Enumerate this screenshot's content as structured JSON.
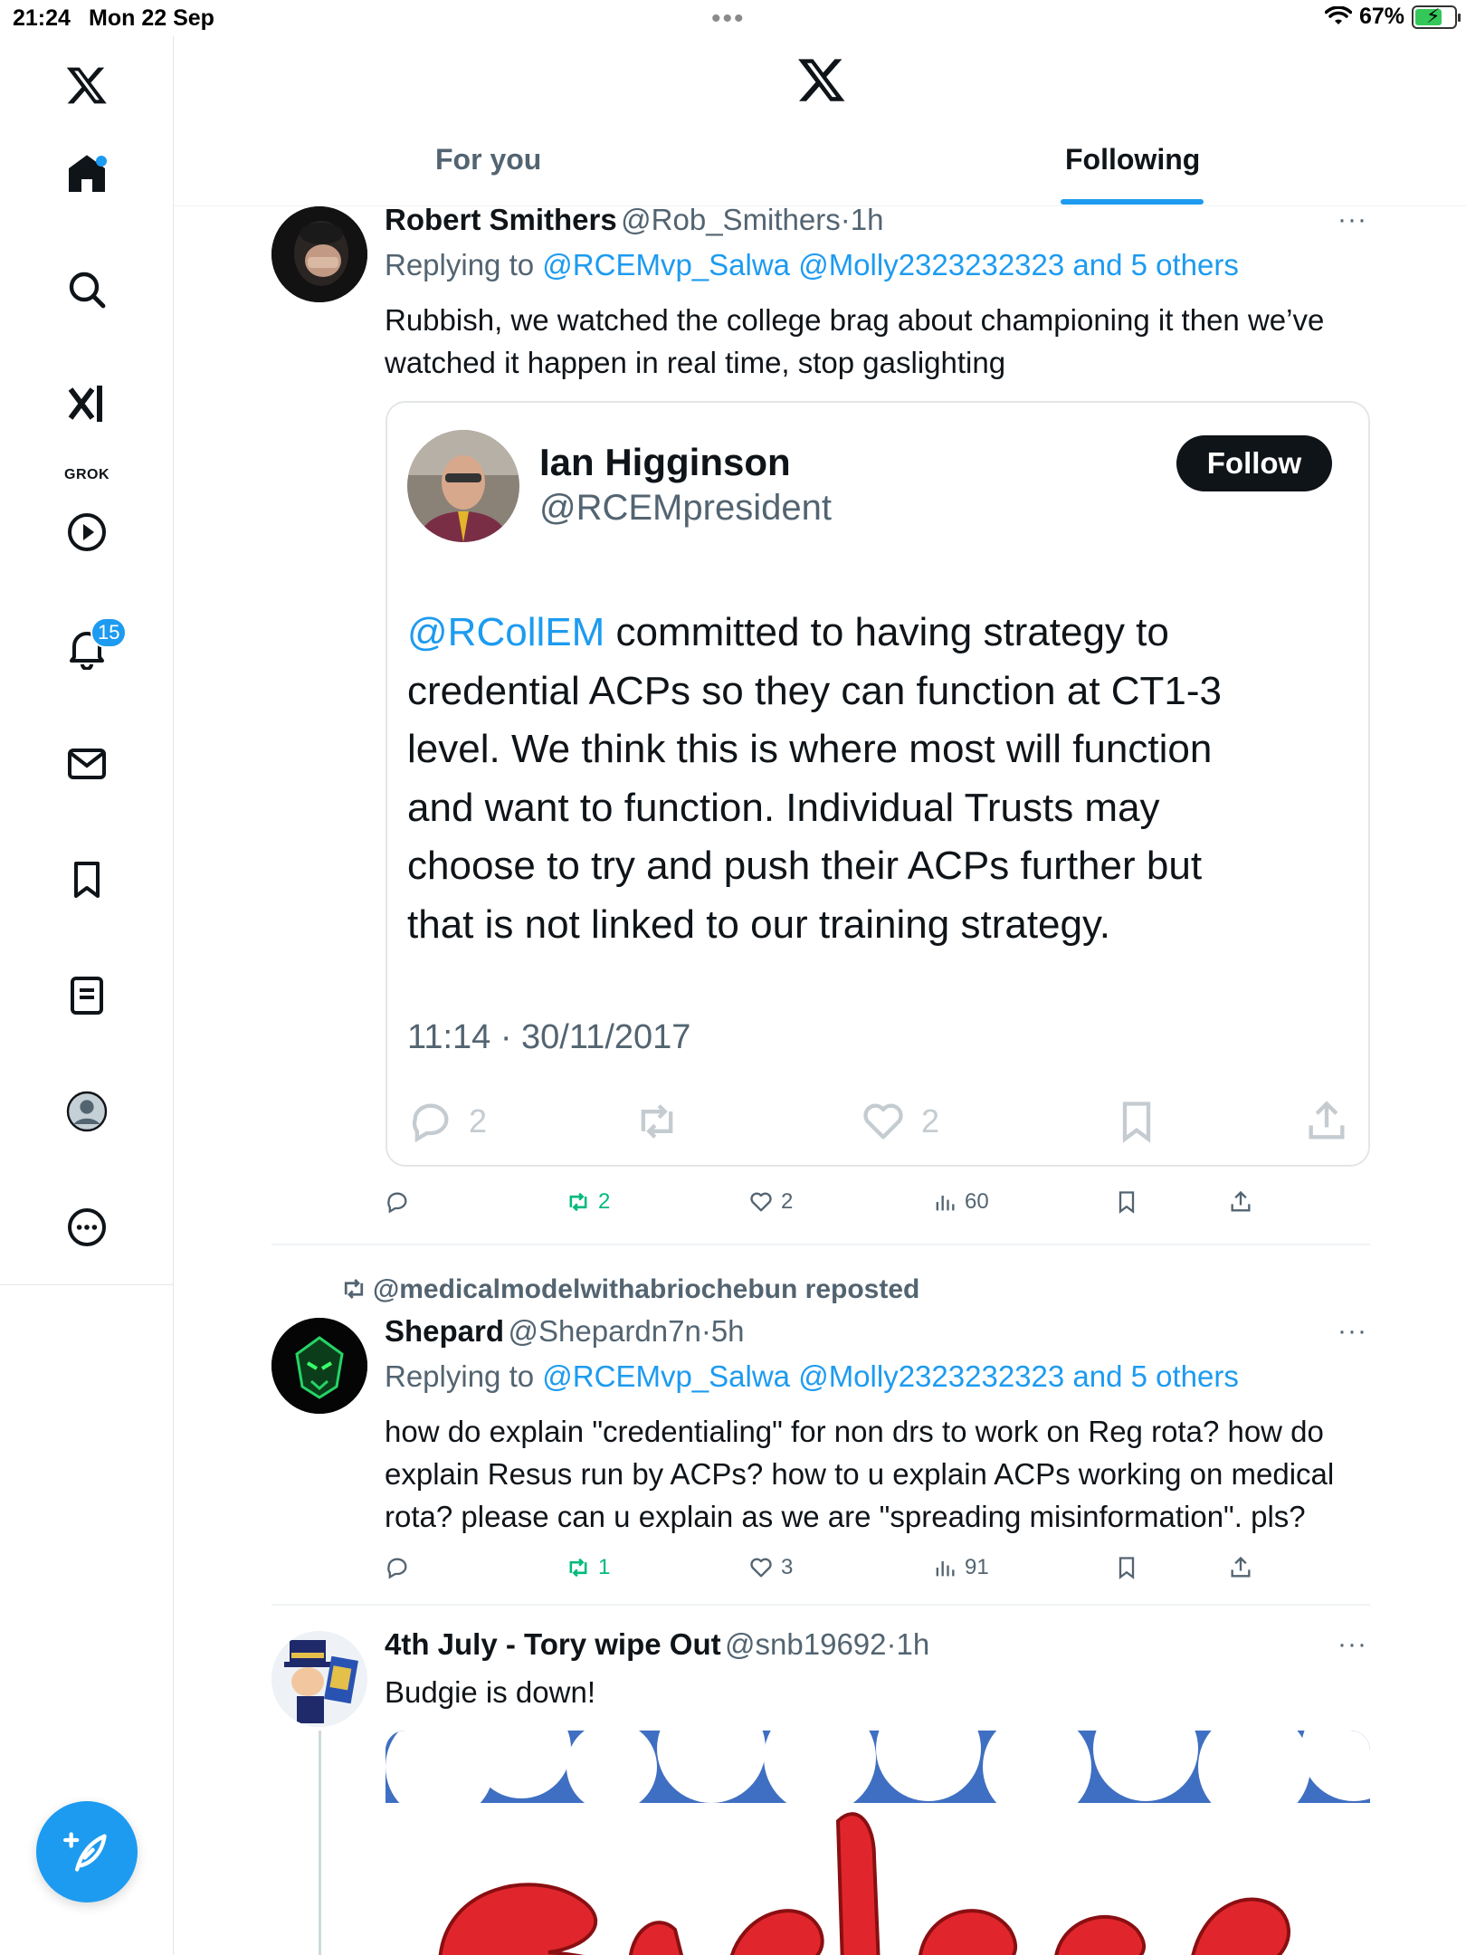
{
  "status_bar": {
    "time": "21:24",
    "date": "Mon 22 Sep",
    "battery": "67%",
    "battery_level": 0.67
  },
  "sidebar": {
    "grok_label": "GROK",
    "notifications_badge": "15",
    "items": [
      "home-icon",
      "search-icon",
      "grok-icon",
      "video-icon",
      "notifications-icon",
      "messages-icon",
      "bookmarks-icon",
      "lists-icon",
      "profile-icon",
      "more-icon"
    ]
  },
  "header": {
    "tabs": [
      {
        "label": "For you",
        "active": false
      },
      {
        "label": "Following",
        "active": true
      }
    ]
  },
  "feed": {
    "posts": [
      {
        "name": "Robert Smithers",
        "handle": "@Rob_Smithers",
        "sep": "·",
        "time": "1h",
        "reply_prefix": "Replying to",
        "reply_mentions": "@RCEMvp_Salwa @Molly2323232323 and 5 others",
        "text_line1": "Rubbish, we watched the college brag about championing it then we’ve",
        "text_line2": "watched it happen in real time, stop gaslighting",
        "quote": {
          "name": "Ian Higginson",
          "handle": "@RCEMpresident",
          "follow_label": "Follow",
          "mention": "@RCollEM",
          "text_line1_rest": " committed to having strategy to",
          "text_line2": "credential ACPs so they can function at CT1-3",
          "text_line3": "level. We think this is where most will function",
          "text_line4": "and want to function. Individual Trusts may",
          "text_line5": "choose to try and push their ACPs further but",
          "text_line6": "that is not linked to our training strategy.",
          "timestamp": "11:14 · 30/11/2017",
          "replies": "2",
          "likes": "2"
        },
        "stats": {
          "reposts": "2",
          "likes": "2",
          "views": "60"
        }
      },
      {
        "reposted_by": "@medicalmodelwithabriochebun reposted",
        "name": "Shepard",
        "handle": "@Shepardn7n",
        "sep": "·",
        "time": "5h",
        "reply_prefix": "Replying to",
        "reply_mentions": "@RCEMvp_Salwa @Molly2323232323 and 5 others",
        "text_line1": "how do explain \"credentialing\" for non drs to work on Reg rota? how do",
        "text_line2": "explain Resus run by ACPs? how to u explain ACPs working on medical",
        "text_line3": "rota? please can u explain as we are \"spreading misinformation\". pls?",
        "stats": {
          "reposts": "1",
          "likes": "3",
          "views": "91"
        }
      },
      {
        "name": "4th July - Tory wipe Out",
        "handle": "@snb19692",
        "sep": "·",
        "time": "1h",
        "text_line1": "Budgie is down!"
      }
    ]
  },
  "colors": {
    "accent": "#1d9bf0",
    "repost_green": "#00ba7c",
    "text_secondary": "#536471"
  }
}
